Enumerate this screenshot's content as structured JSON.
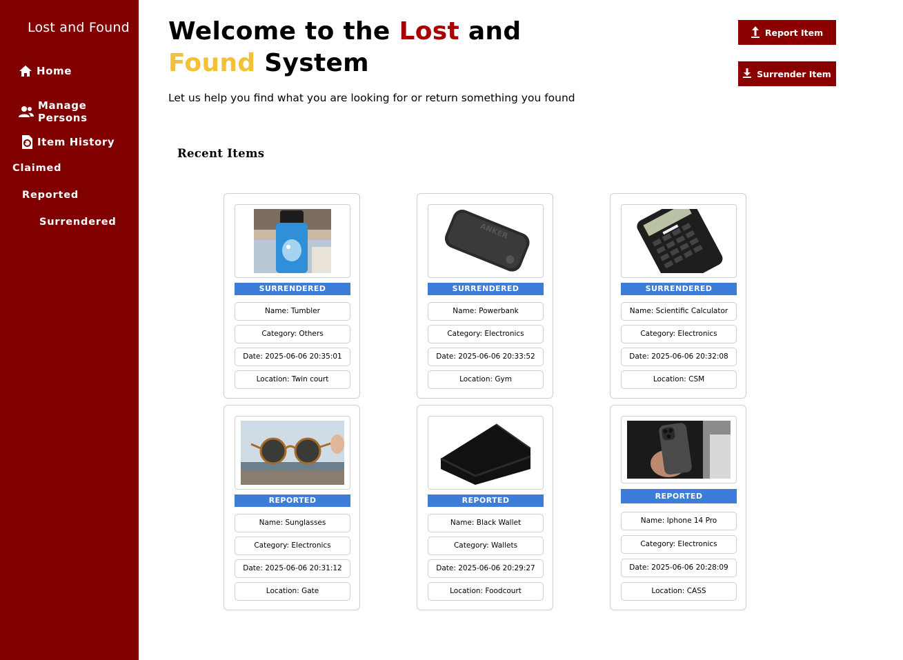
{
  "sidebar": {
    "app_title": "Lost and Found",
    "nav": [
      {
        "label": "Home",
        "icon": "home-icon"
      },
      {
        "label": "Manage Persons",
        "icon": "people-icon"
      },
      {
        "label": "Item History",
        "icon": "history-icon"
      }
    ],
    "sub_items": [
      "Claimed",
      "Reported",
      "Surrendered"
    ]
  },
  "header": {
    "line1_part1": "Welcome to the ",
    "line1_highlight": "Lost",
    "line1_part2": " and",
    "line2_highlight": "Found",
    "line2_part2": " System",
    "subtitle": "Let us help you find what you are looking for or return something you found",
    "highlight_colors": {
      "lost": "#a80000",
      "found": "#f2c136"
    }
  },
  "actions": {
    "report_label": "Report Item",
    "surrender_label": "Surrender Item"
  },
  "section_title": "Recent Items",
  "items": [
    {
      "status": "SURRENDERED",
      "name": "Name: Tumbler",
      "category": "Category: Others",
      "date": "Date: 2025-06-06 20:35:01",
      "location": "Location: Twin court",
      "image": "tumbler"
    },
    {
      "status": "SURRENDERED",
      "name": "Name: Powerbank",
      "category": "Category: Electronics",
      "date": "Date: 2025-06-06 20:33:52",
      "location": "Location: Gym",
      "image": "powerbank"
    },
    {
      "status": "SURRENDERED",
      "name": "Name: Scientific Calculator",
      "category": "Category: Electronics",
      "date": "Date: 2025-06-06 20:32:08",
      "location": "Location: CSM",
      "image": "calculator"
    },
    {
      "status": "REPORTED",
      "name": "Name: Sunglasses",
      "category": "Category: Electronics",
      "date": "Date: 2025-06-06 20:31:12",
      "location": "Location: Gate",
      "image": "sunglasses"
    },
    {
      "status": "REPORTED",
      "name": "Name: Black Wallet",
      "category": "Category: Wallets",
      "date": "Date: 2025-06-06 20:29:27",
      "location": "Location: Foodcourt",
      "image": "wallet"
    },
    {
      "status": "REPORTED",
      "name": "Name: Iphone 14 Pro",
      "category": "Category: Electronics",
      "date": "Date: 2025-06-06 20:28:09",
      "location": "Location: CASS",
      "image": "phone"
    }
  ],
  "colors": {
    "sidebar": "#800000",
    "button": "#8a0000",
    "status_badge": "#3b7dd8"
  }
}
